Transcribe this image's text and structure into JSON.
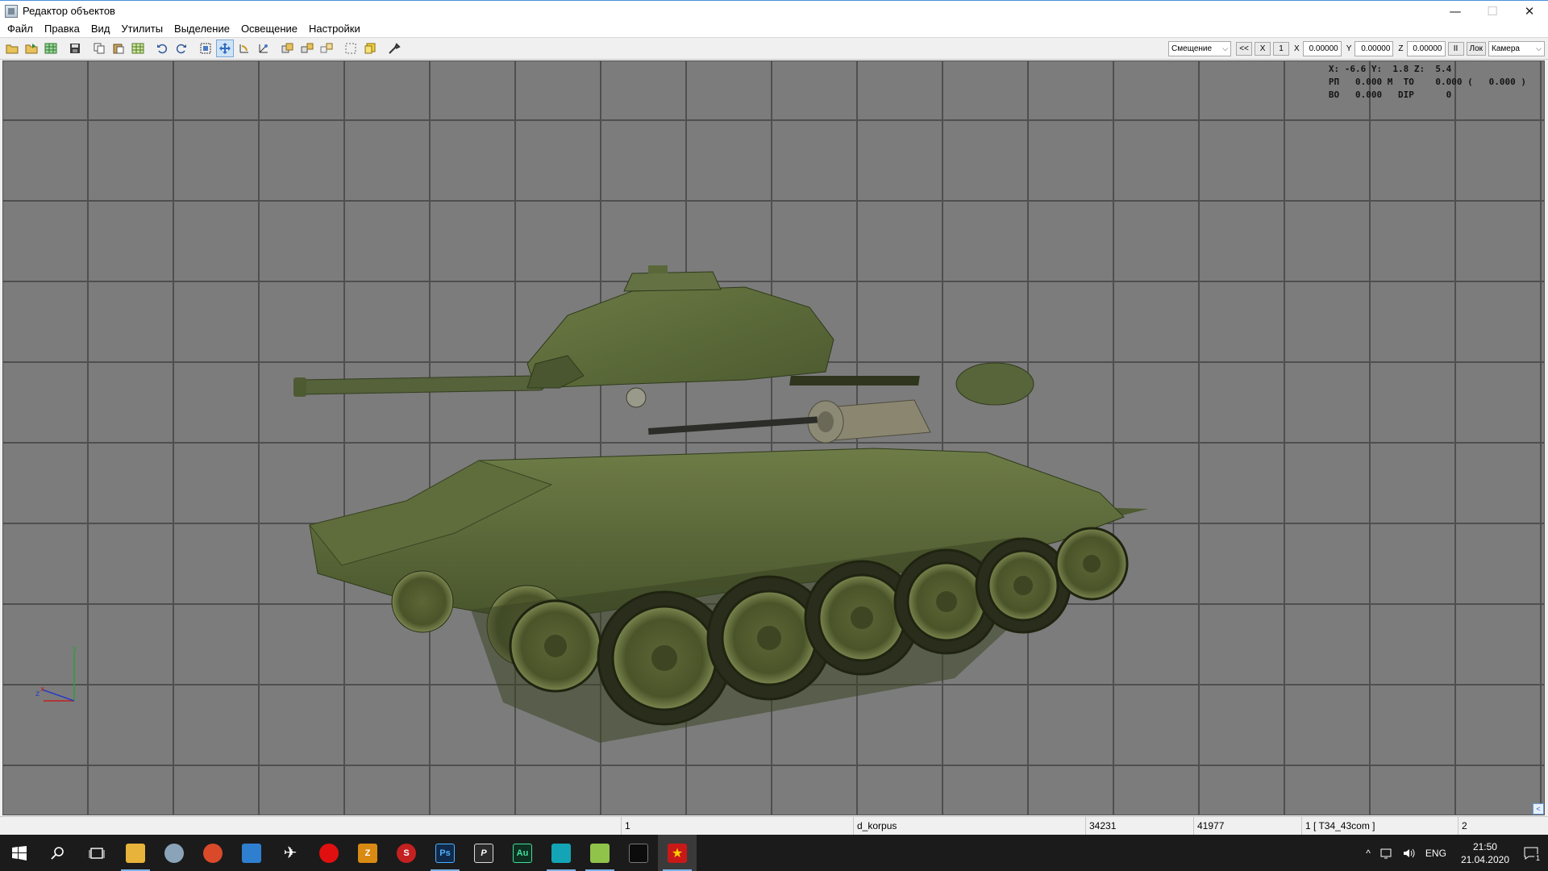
{
  "window": {
    "title": "Редактор объектов",
    "controls": {
      "minimize": "—",
      "maximize": "☐",
      "close": "✕"
    }
  },
  "menu": [
    "Файл",
    "Правка",
    "Вид",
    "Утилиты",
    "Выделение",
    "Освещение",
    "Настройки"
  ],
  "toolbar": {
    "icons": [
      "open-icon",
      "import-icon",
      "grid-icon",
      "save-icon",
      "copy-icon",
      "paste-icon",
      "select-all-icon",
      "undo-icon",
      "redo-icon",
      "select-object-icon",
      "move-icon",
      "rotate-icon",
      "scale-icon",
      "group-icon",
      "ungroup-icon",
      "attach-icon",
      "box-select-icon",
      "material-icon",
      "tools-icon"
    ],
    "active_tool": "move-icon",
    "mode_select": "Смещение",
    "btn_back": "<<",
    "btn_x": "X",
    "btn_one": "1",
    "x_label": "X",
    "x_value": "0.00000",
    "y_label": "Y",
    "y_value": "0.00000",
    "z_label": "Z",
    "z_value": "0.00000",
    "btn_pause": "II",
    "btn_loc": "Лок",
    "camera_select": "Камера"
  },
  "viewport": {
    "readout": {
      "r1": [
        "X:",
        " -6.6",
        " Y:",
        "  1.8",
        " Z:",
        "  5.4"
      ],
      "r2": [
        "РП",
        "   0.000",
        " М",
        "  ТО",
        "    0.000",
        " (",
        "   0.000",
        " )"
      ],
      "r3": [
        "ВО",
        "   0.000",
        "   DIP",
        "      0"
      ]
    },
    "axis_labels": {
      "y": "y",
      "z": "z",
      "x": "x"
    },
    "colors": {
      "background": "#7c7c7c",
      "grid": "#4f4f4f",
      "hull": "#5b6a38"
    }
  },
  "status": {
    "c1": "1",
    "c2": "d_korpus",
    "c3": "34231",
    "c4": "41977",
    "c5": "1 [ T34_43com ]",
    "c6": "2"
  },
  "taskbar": {
    "apps": [
      "start-icon",
      "search-icon",
      "task-view-icon",
      "file-explorer-icon",
      "app-brush-icon",
      "app-red-circle-icon",
      "app-blue-icon",
      "app-plane-icon",
      "app-record-icon",
      "app-filezilla-icon",
      "app-s-icon",
      "photoshop-icon",
      "app-p-icon",
      "audition-icon",
      "app-cyan-icon",
      "notepad-icon",
      "terminal-icon",
      "object-editor-icon"
    ],
    "labels": {
      "ps": "Ps",
      "au": "Au",
      "p": "P",
      "z": "Z",
      "s": "S"
    },
    "tray_lang": "ENG",
    "time": "21:50",
    "date": "21.04.2020",
    "notif_count": "1"
  }
}
